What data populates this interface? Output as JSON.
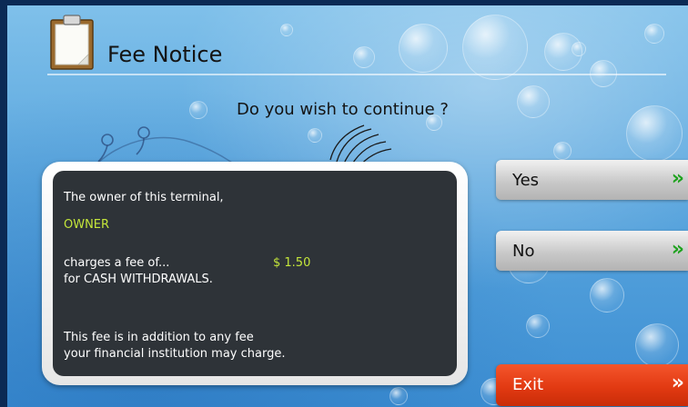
{
  "header": {
    "title": "Fee Notice",
    "icon": "clipboard-icon"
  },
  "prompt": {
    "question": "Do you wish to continue ?"
  },
  "notice": {
    "line1": "The owner of this terminal,",
    "owner": "OWNER",
    "fee_text": "charges a fee of...",
    "fee_amount": "$ 1.50",
    "fee_for": "for CASH WITHDRAWALS.",
    "footer1": "This fee is in addition to any fee",
    "footer2": "your financial institution may charge.",
    "accent_color": "#c4e63a"
  },
  "buttons": {
    "yes": {
      "label": "Yes",
      "icon": "double-chevron-right-icon"
    },
    "no": {
      "label": "No",
      "icon": "double-chevron-right-icon"
    },
    "exit": {
      "label": "Exit",
      "icon": "double-chevron-right-icon"
    },
    "chevron_glyph": "»",
    "chevron_color": "#1ea21e",
    "exit_color": "#e23a12"
  }
}
